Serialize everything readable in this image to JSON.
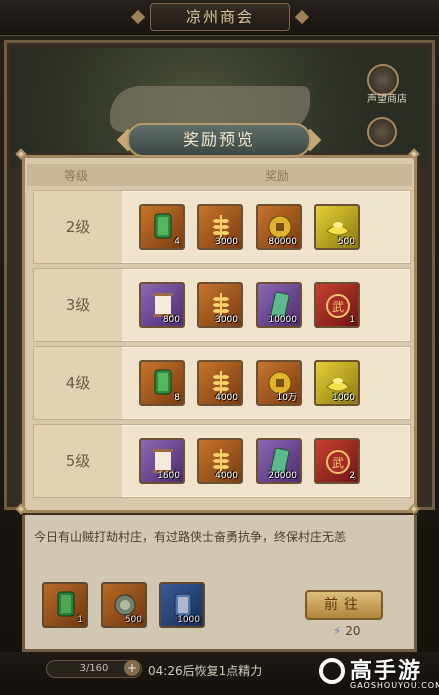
{
  "window": {
    "title": "凉州商会"
  },
  "side_links": [
    {
      "label": "声望商店",
      "icon": "shop-banner-icon"
    },
    {
      "label": "",
      "icon": "quest-icon"
    }
  ],
  "event": {
    "description": "今日有山贼打劫村庄，有过路侠士奋勇抗争，终保村庄无恙",
    "items": [
      {
        "icon": "green-token-icon",
        "count": "1",
        "bg": "orange"
      },
      {
        "icon": "medal-icon",
        "count": "500",
        "bg": "orange"
      },
      {
        "icon": "blue-token-icon",
        "count": "1000",
        "bg": "blue"
      }
    ],
    "go_button": "前往",
    "cost": "20"
  },
  "status_bar": {
    "energy": "3/160",
    "recover_text": "04:26后恢复1点精力"
  },
  "watermark": {
    "title": "高手游",
    "sub": "GAOSHOUYOU.COM"
  },
  "modal": {
    "title": "奖励预览",
    "headers": {
      "level": "等级",
      "reward": "奖励"
    },
    "rows": [
      {
        "level": "2级",
        "items": [
          {
            "icon": "green-token-icon",
            "count": "4",
            "bg": "orange"
          },
          {
            "icon": "wheat-icon",
            "count": "3000",
            "bg": "orange"
          },
          {
            "icon": "copper-coin-icon",
            "count": "80000",
            "bg": "orange"
          },
          {
            "icon": "gold-ingot-icon",
            "count": "500",
            "bg": "yellow"
          }
        ]
      },
      {
        "level": "3级",
        "items": [
          {
            "icon": "scroll-icon",
            "count": "800",
            "bg": "purple"
          },
          {
            "icon": "wheat-icon",
            "count": "3000",
            "bg": "orange"
          },
          {
            "icon": "jade-token-icon",
            "count": "10000",
            "bg": "purple"
          },
          {
            "icon": "war-medal-icon",
            "count": "1",
            "bg": "red"
          }
        ]
      },
      {
        "level": "4级",
        "items": [
          {
            "icon": "green-token-icon",
            "count": "8",
            "bg": "orange"
          },
          {
            "icon": "wheat-icon",
            "count": "4000",
            "bg": "orange"
          },
          {
            "icon": "copper-coin-icon",
            "count": "10万",
            "bg": "orange"
          },
          {
            "icon": "gold-ingot-icon",
            "count": "1000",
            "bg": "yellow"
          }
        ]
      },
      {
        "level": "5级",
        "items": [
          {
            "icon": "scroll-icon",
            "count": "1600",
            "bg": "purple"
          },
          {
            "icon": "wheat-icon",
            "count": "4000",
            "bg": "orange"
          },
          {
            "icon": "jade-token-icon",
            "count": "20000",
            "bg": "purple"
          },
          {
            "icon": "war-medal-icon",
            "count": "2",
            "bg": "red"
          }
        ]
      }
    ]
  }
}
